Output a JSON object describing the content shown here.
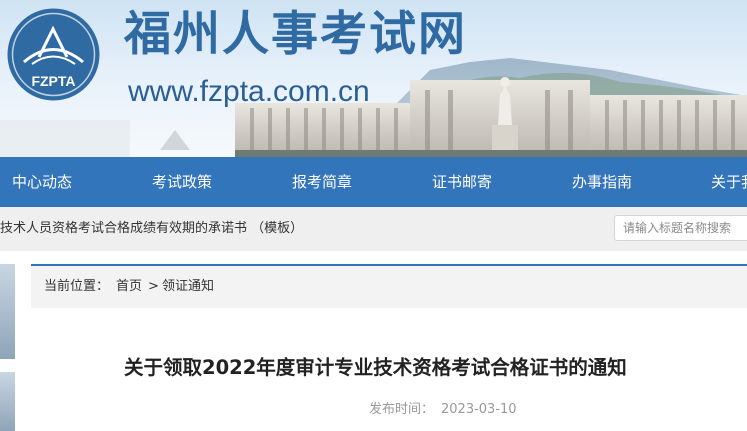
{
  "header": {
    "site_title": "福州人事考试网",
    "site_url": "www.fzpta.com.cn",
    "logo_text": "FZPTA"
  },
  "nav": {
    "items": [
      {
        "label": "中心动态"
      },
      {
        "label": "考试政策"
      },
      {
        "label": "报考简章"
      },
      {
        "label": "证书邮寄"
      },
      {
        "label": "办事指南"
      },
      {
        "label": "关于我"
      }
    ]
  },
  "subbar": {
    "marquee_text": "技术人员资格考试合格成绩有效期的承诺书 （模板）",
    "search_placeholder": "请输入标题名称搜索"
  },
  "breadcrumb": {
    "prefix": "当前位置：",
    "home": "首页",
    "separator": ">",
    "current": "领证通知"
  },
  "article": {
    "title": "关于领取2022年度审计专业技术资格考试合格证书的通知",
    "publish_label": "发布时间：",
    "publish_date": "2023-03-10"
  },
  "colors": {
    "brand_blue": "#3375ba",
    "title_blue": "#2f6aa3",
    "subbar_gray": "#efefef"
  }
}
